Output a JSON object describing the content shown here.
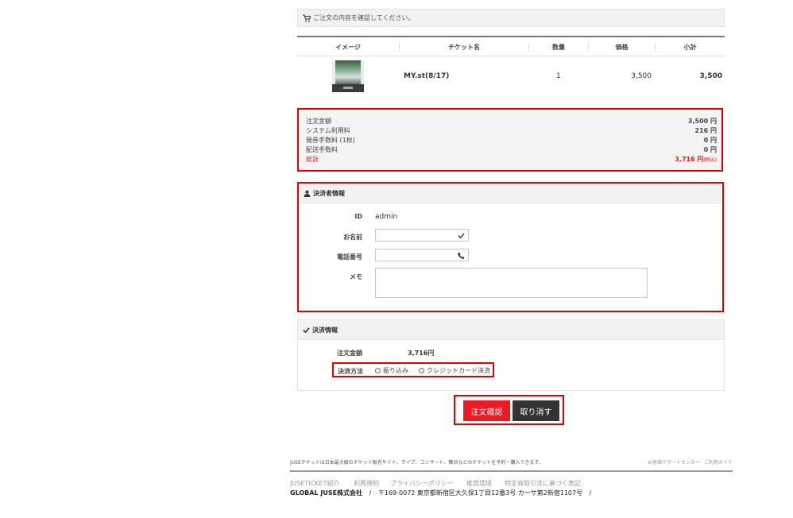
{
  "notice": {
    "text": "ご注文の内容を確認してください。",
    "icon": "cart-icon"
  },
  "table": {
    "headers": [
      "イメージ",
      "チケット名",
      "数量",
      "価格",
      "小計"
    ],
    "rows": [
      {
        "name": "MY.st(8/17)",
        "qty": "1",
        "price": "3,500",
        "subtotal": "3,500"
      }
    ]
  },
  "summary": {
    "order_amount_label": "注文金額",
    "order_amount": "3,500 円",
    "system_fee_label": "システム利用料",
    "system_fee": "216 円",
    "issue_fee_label": "発券手数料 (1枚)",
    "issue_fee": "0 円",
    "delivery_fee_label": "配送手数料",
    "delivery_fee": "0 円",
    "total_label": "総計",
    "total": "3,716 円",
    "total_tax_note": "(税込)",
    "total_color": "#e02020"
  },
  "payer": {
    "title": "決済者情報",
    "icon": "user-icon",
    "id_label": "ID",
    "id_value": "admin",
    "name_label": "お名前",
    "name_value": "",
    "phone_label": "電話番号",
    "phone_value": "",
    "memo_label": "メモ",
    "memo_value": ""
  },
  "payment": {
    "title": "決済情報",
    "icon": "check-icon",
    "amount_label": "注文金額",
    "amount": "3,716円",
    "method_label": "決済方法",
    "options": [
      "振り込み",
      "クレジットカード決済"
    ]
  },
  "actions": {
    "confirm": "注文確認",
    "cancel": "取り消す",
    "confirm_color": "#e81c24",
    "cancel_color": "#333333"
  },
  "footer": {
    "description": "JUSEチケットは日本最大級のチケット販売サイト。ライブ、コンサート、舞台などのチケットを予約・購入できます。",
    "support": "お客様サポートセンター",
    "guide": "ご利用ガイド",
    "nav": [
      "JUSETICKET紹介",
      "利用規約",
      "プライバシーポリシー",
      "推奨環境",
      "特定商取引法に基づく表記"
    ],
    "company": "GLOBAL JUSE株式会社",
    "address": "〒169-0072 東京都新宿区大久保1丁目12番3号 カーサ第2新宿1107号",
    "sep": "/"
  }
}
